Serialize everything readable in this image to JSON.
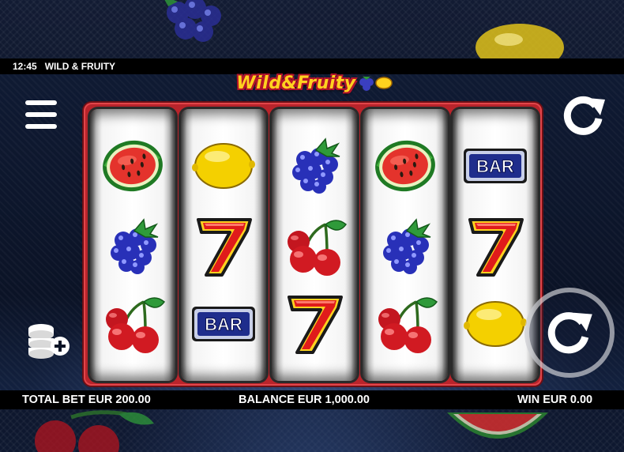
{
  "status_bar": {
    "time": "12:45",
    "game_title": "WILD & FRUITY"
  },
  "logo": {
    "text": "Wild&Fruity"
  },
  "reels": [
    [
      "watermelon",
      "blackberry",
      "cherry"
    ],
    [
      "lemon",
      "seven",
      "bar"
    ],
    [
      "blackberry",
      "cherry",
      "seven"
    ],
    [
      "watermelon",
      "blackberry",
      "cherry"
    ],
    [
      "bar",
      "seven",
      "lemon"
    ]
  ],
  "bar_symbol_label": "BAR",
  "icons": {
    "menu": "menu-icon",
    "autoplay": "refresh-icon",
    "bet": "coins-plus-icon",
    "spin": "spin-icon"
  },
  "footer": {
    "total_bet": "TOTAL BET EUR 200.00",
    "balance": "BALANCE EUR 1,000.00",
    "win": "WIN EUR 0.00"
  },
  "colors": {
    "frame_red": "#b9242b",
    "logo_yellow": "#ffd21f",
    "bar_blue": "#1f2d8c"
  }
}
